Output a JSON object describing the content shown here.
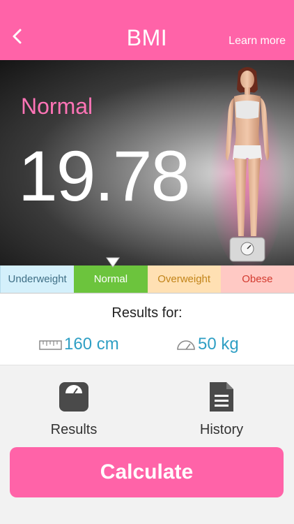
{
  "header": {
    "title": "BMI",
    "learn_more": "Learn more"
  },
  "result": {
    "status": "Normal",
    "bmi": "19.78"
  },
  "ranges": [
    "Underweight",
    "Normal",
    "Overweight",
    "Obese"
  ],
  "selected_range": "Normal",
  "inputs": {
    "results_label": "Results for:",
    "height": "160 cm",
    "weight": "50 kg"
  },
  "nav": {
    "results": "Results",
    "history": "History"
  },
  "actions": {
    "calculate": "Calculate"
  },
  "colors": {
    "brand": "#ff63a8",
    "status_text": "#ff74b6",
    "normal": "#6cc43d",
    "underweight": "#d4f0fb",
    "overweight": "#ffe0b3",
    "obese": "#ffc9c4",
    "value_text": "#2f9fc4"
  },
  "icons": [
    "back-chevron-icon",
    "ruler-icon",
    "scale-gauge-icon",
    "bathroom-scale-icon",
    "document-icon"
  ]
}
